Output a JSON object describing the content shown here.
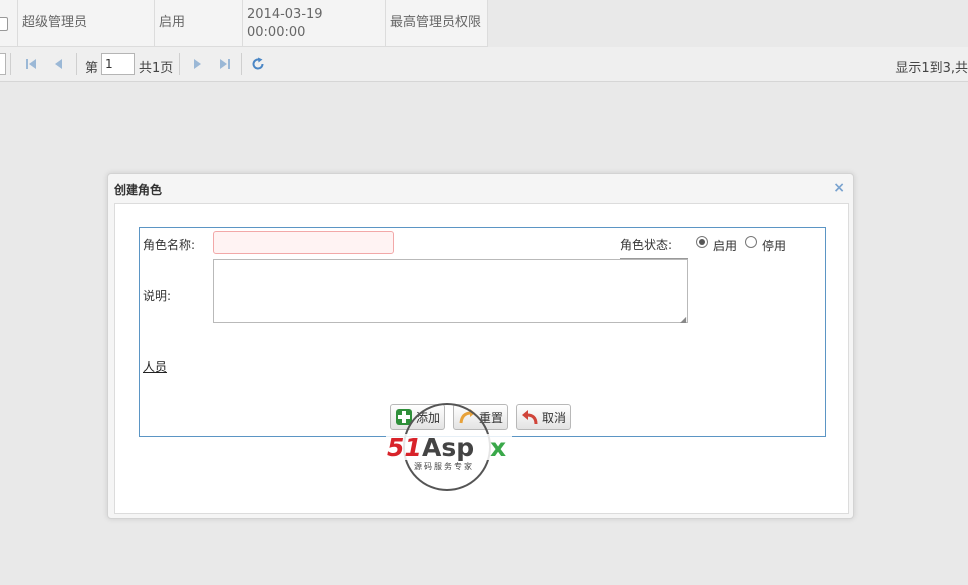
{
  "grid": {
    "row": {
      "name": "超级管理员",
      "status": "启用",
      "date_line1": "2014-03-19",
      "date_line2": "00:00:00",
      "description": "最高管理员权限"
    }
  },
  "pager": {
    "page_prefix": "第",
    "page_value": "1",
    "page_total": "共1页",
    "info": "显示1到3,共"
  },
  "dialog": {
    "title": "创建角色",
    "close": "×",
    "form": {
      "role_name_label": "角色名称:",
      "role_name_value": "",
      "role_status_label": "角色状态:",
      "status_options": [
        {
          "label": "启用",
          "checked": true
        },
        {
          "label": "停用",
          "checked": false
        }
      ],
      "description_label": "说明:",
      "description_value": "",
      "people_link": "人员"
    },
    "buttons": {
      "add": "添加",
      "reset": "重置",
      "cancel": "取消"
    }
  },
  "watermark": {
    "brand_red": "51",
    "brand_dark": "Aspx",
    "tagline": "源码服务专家"
  },
  "colors": {
    "accent_blue": "#5b95c4",
    "invalid_input_bg": "#fff3f3",
    "invalid_input_border": "#f2a8a8",
    "watermark_red": "#d8232a",
    "watermark_green": "#3aa84a"
  }
}
